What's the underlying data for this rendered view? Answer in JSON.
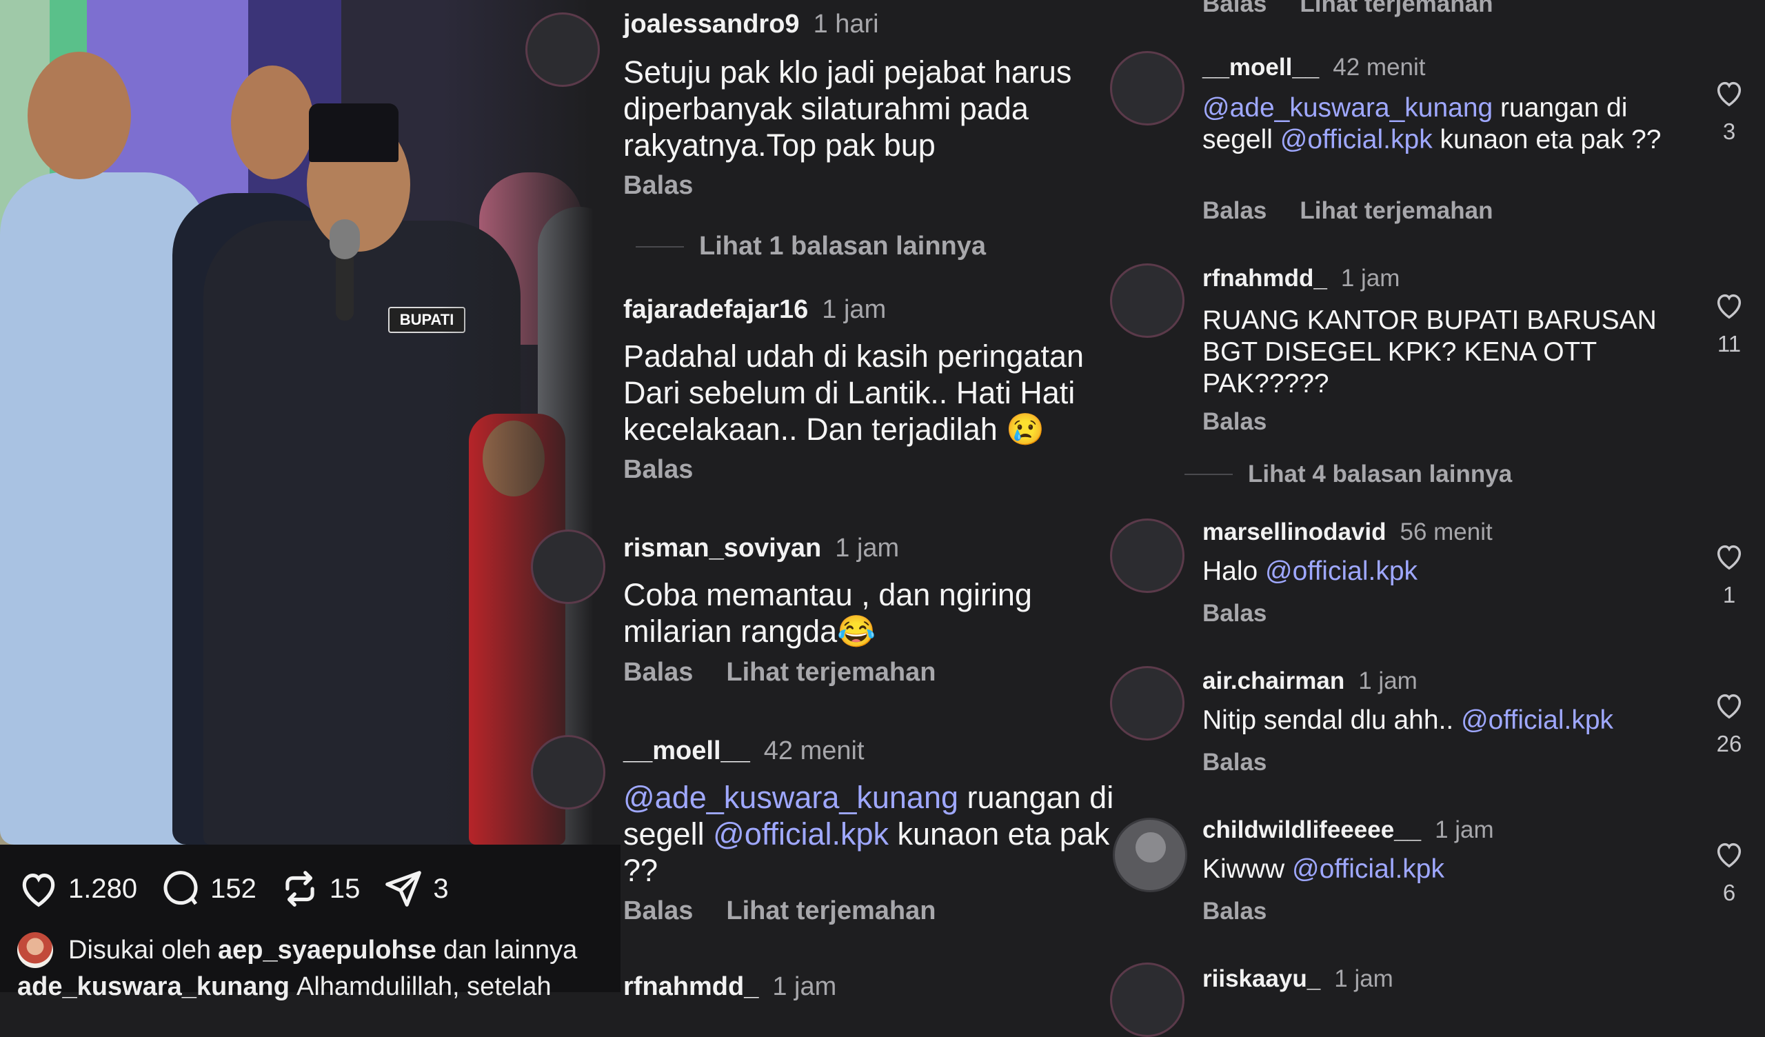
{
  "post": {
    "likes": "1.280",
    "comments": "152",
    "reposts": "15",
    "shares": "3",
    "badge_text": "BUPATI",
    "liked_by": {
      "prefix": "Disukai oleh",
      "user": "aep_syaepulohse",
      "suffix": "dan lainnya"
    },
    "caption": {
      "user": "ade_kuswara_kunang",
      "text": "Alhamdulillah, setelah"
    }
  },
  "middle_comments": [
    {
      "user": "joalessandro9",
      "time": "1 hari",
      "text": "Setuju pak klo jadi pejabat harus diperbanyak silaturahmi pada rakyatnya.Top pak bup",
      "reply": "Balas"
    },
    {
      "more_replies": "Lihat 1 balasan lainnya"
    },
    {
      "user": "fajaradefajar16",
      "time": "1 jam",
      "text": "Padahal udah di kasih peringatan Dari sebelum di Lantik.. Hati Hati kecelakaan.. Dan terjadilah 😢",
      "reply": "Balas"
    },
    {
      "user": "risman_soviyan",
      "time": "1 jam",
      "text": "Coba memantau , dan ngiring milarian rangda😂",
      "reply": "Balas",
      "translate": "Lihat terjemahan"
    },
    {
      "user": "__moell__",
      "time": "42 menit",
      "mention1": "@ade_kuswara_kunang",
      "text1": " ruangan di segell ",
      "mention2": "@official.kpk",
      "text2": " kunaon eta pak ??",
      "reply": "Balas",
      "translate": "Lihat terjemahan"
    },
    {
      "user": "rfnahmdd_",
      "time": "1 jam"
    }
  ],
  "right_comments": [
    {
      "reply": "Balas",
      "translate": "Lihat terjemahan"
    },
    {
      "user": "__moell__",
      "time": "42 menit",
      "mention1": "@ade_kuswara_kunang",
      "text1": " ruangan di segell ",
      "mention2": "@official.kpk",
      "text2": " kunaon eta pak ??",
      "reply": "Balas",
      "translate": "Lihat terjemahan",
      "likes": "3"
    },
    {
      "user": "rfnahmdd_",
      "time": "1 jam",
      "text": "RUANG KANTOR BUPATI BARUSAN BGT DISEGEL KPK? KENA OTT PAK?????",
      "reply": "Balas",
      "likes": "11"
    },
    {
      "more_replies": "Lihat 4 balasan lainnya"
    },
    {
      "user": "marsellinodavid",
      "time": "56 menit",
      "text": "Halo ",
      "mention": "@official.kpk",
      "reply": "Balas",
      "likes": "1"
    },
    {
      "user": "air.chairman",
      "time": "1 jam",
      "text": "Nitip sendal dlu ahh.. ",
      "mention": "@official.kpk",
      "reply": "Balas",
      "likes": "26"
    },
    {
      "user": "childwildlifeeeee__",
      "time": "1 jam",
      "text": "Kiwww ",
      "mention": "@official.kpk",
      "reply": "Balas",
      "likes": "6"
    },
    {
      "user": "riiskaayu_",
      "time": "1 jam"
    }
  ]
}
